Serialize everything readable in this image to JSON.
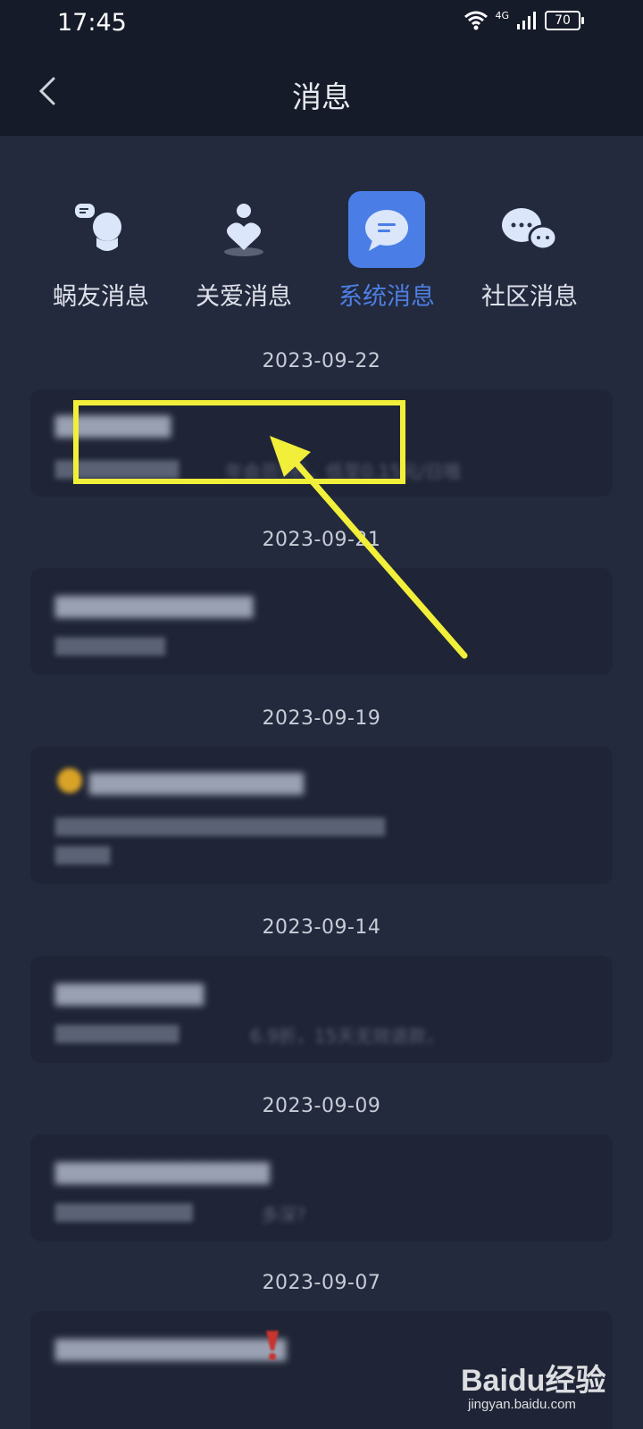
{
  "status_bar": {
    "time": "17:45",
    "network": "4G",
    "battery": "70"
  },
  "header": {
    "title": "消息"
  },
  "tabs": [
    {
      "label": "蜗友消息",
      "icon": "chat-person-icon",
      "active": false
    },
    {
      "label": "关爱消息",
      "icon": "heart-person-icon",
      "active": false
    },
    {
      "label": "系统消息",
      "icon": "message-bubble-icon",
      "active": true
    },
    {
      "label": "社区消息",
      "icon": "community-chat-icon",
      "active": false
    }
  ],
  "messages": [
    {
      "date": "2023-09-22",
      "title": "",
      "subtitle": "年会员5折，低至0.15元/日哦"
    },
    {
      "date": "2023-09-21",
      "title": "",
      "subtitle": ""
    },
    {
      "date": "2023-09-19",
      "title": "",
      "subtitle": ""
    },
    {
      "date": "2023-09-14",
      "title": "",
      "subtitle": "6.9折，15天无效退款，"
    },
    {
      "date": "2023-09-09",
      "title": "",
      "subtitle": "多深?"
    },
    {
      "date": "2023-09-07",
      "title": "",
      "subtitle": ""
    }
  ],
  "watermark": {
    "brand": "Baidu经验",
    "url": "jingyan.baidu.com"
  },
  "colors": {
    "background": "#232a3e",
    "header": "#161b29",
    "accent": "#4a7ee6",
    "highlight": "#f2ef3a"
  }
}
